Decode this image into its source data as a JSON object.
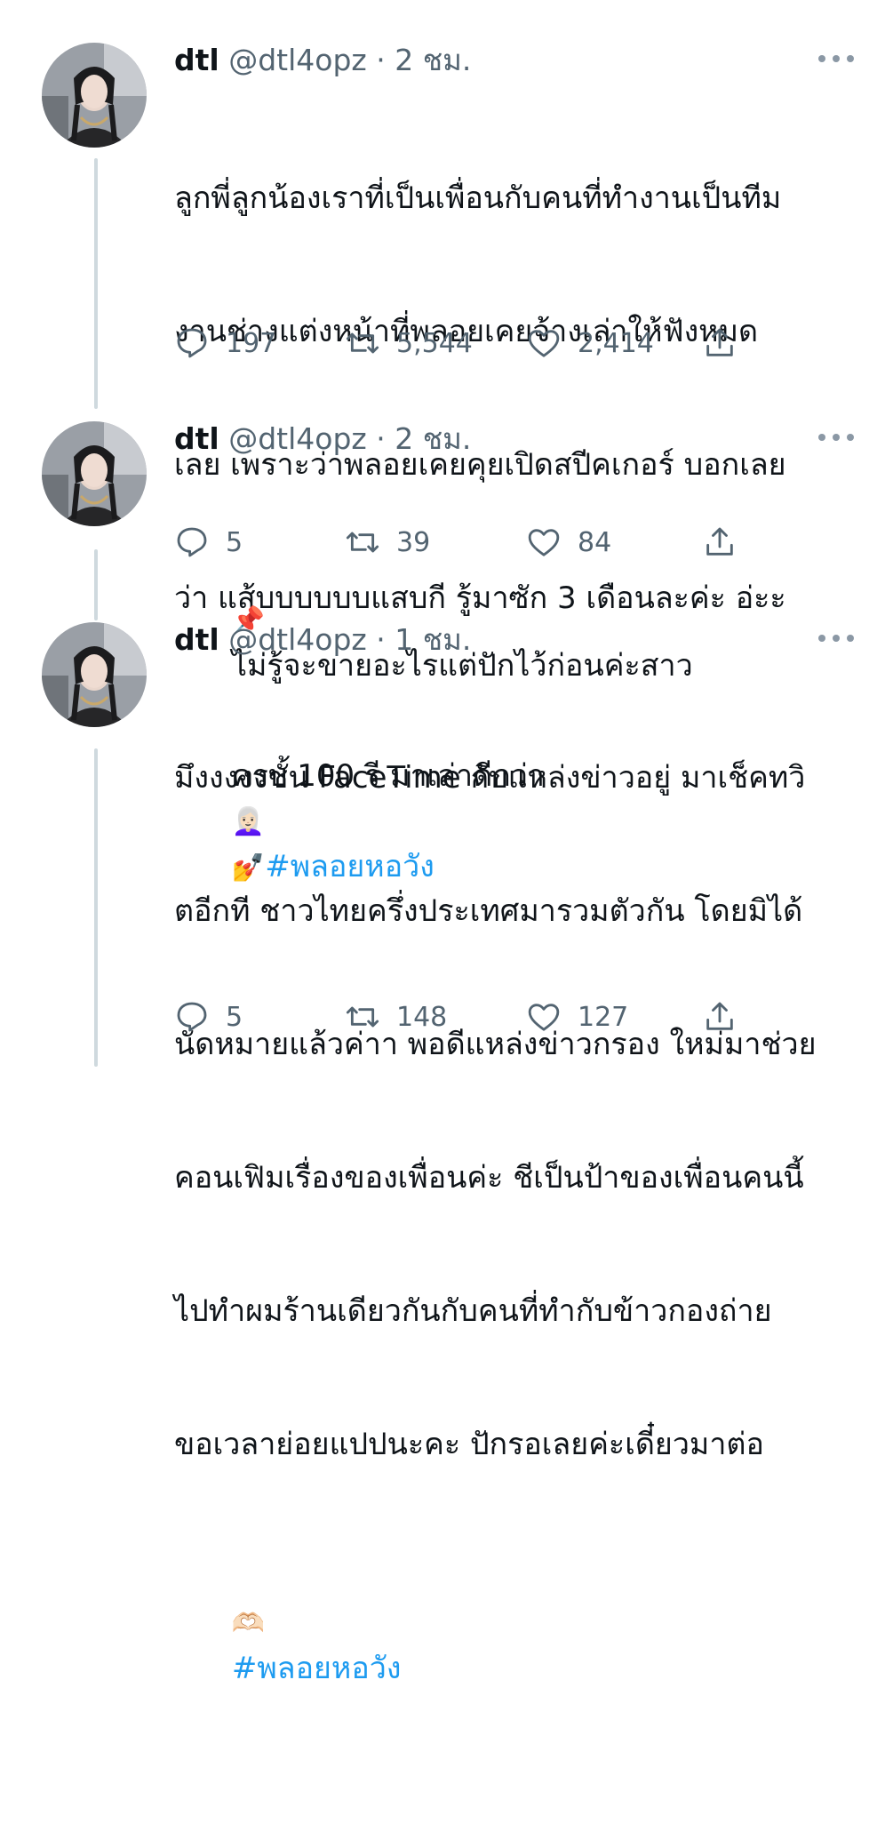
{
  "tweets": [
    {
      "name": "dtl",
      "handle": "@dtl4opz",
      "dot": "·",
      "time": "2 ชม.",
      "text_lines": [
        "ลูกพี่ลูกน้องเราที่เป็นเพื่อนกับคนที่ทำงานเป็นทีม",
        "งานช่างแต่งหน้าที่พลอยเคยจ้างเล่าให้ฟังหมด",
        "เลย เพราะว่าพลอยเคยคุยเปิดสปีคเกอร์ บอกเลย",
        "ว่า แส้บบบบบบแสบกี รู้มาซัก 3 เดือนละค่ะ อ่ะะ",
        "ครบ 100 รี มาเล่าดีกว่า"
      ],
      "emoji1": "👩🏻‍🦳",
      "emoji2": "💅",
      "hashtag": "#พลอยหอวัง",
      "replies": "197",
      "retweets": "5,544",
      "likes": "2,414"
    },
    {
      "name": "dtl",
      "handle": "@dtl4opz",
      "dot": "·",
      "time": "2 ชม.",
      "emoji": "📌",
      "text": "ไม่รู้จะขายอะไรแต่ปักไว้ก่อนค่ะสาว",
      "replies": "5",
      "retweets": "39",
      "likes": "84"
    },
    {
      "name": "dtl",
      "handle": "@dtl4opz",
      "dot": "·",
      "time": "1 ชม.",
      "text_lines": [
        "มึงงงงงชั้น FaceTime กับแหล่งข่าวอยู่ มาเช็คทวิ",
        "ตอีกที ชาวไทยครึ่งประเทศมารวมตัวกัน โดยมิได้",
        "นัดหมายแล้วค่าา พอดีแหล่งข่าวกรอง ใหม่มาช่วย",
        "คอนเฟิมเรื่องของเพื่อนค่ะ ชีเป็นป้าของเพื่อนคนนี้",
        "ไปทำผมร้านเดียวกันกับคนที่ทำกับข้าวกองถ่าย",
        "ขอเวลาย่อยแปปนะคะ ปักรอเลยค่ะเดี๋ยวมาต่อ"
      ],
      "emoji": "🫶🏻",
      "hashtag": "#พลอยหอวัง",
      "replies": "5",
      "retweets": "148",
      "likes": "127"
    }
  ]
}
